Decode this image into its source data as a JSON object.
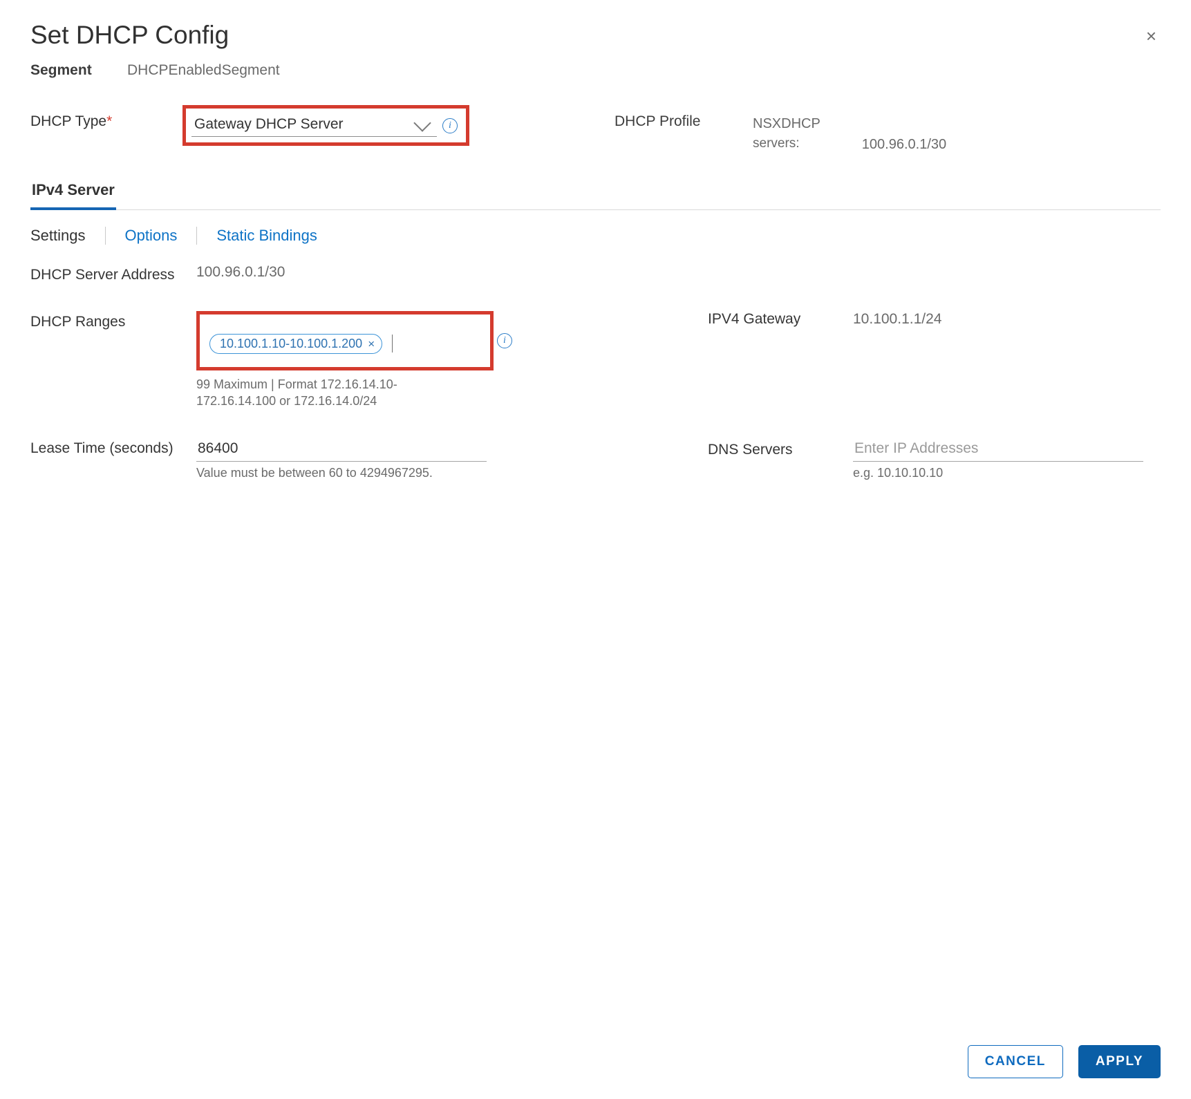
{
  "dialog": {
    "title": "Set DHCP Config",
    "close_glyph": "×"
  },
  "segment": {
    "label": "Segment",
    "value": "DHCPEnabledSegment"
  },
  "dhcp_type": {
    "label": "DHCP Type",
    "required_mark": "*",
    "selected": "Gateway DHCP Server"
  },
  "dhcp_profile": {
    "label": "DHCP Profile",
    "name": "NSXDHCP",
    "servers_label": "servers:",
    "servers_value": "100.96.0.1/30"
  },
  "tab1": {
    "label": "IPv4 Server"
  },
  "subtabs": {
    "settings": "Settings",
    "options": "Options",
    "static_bindings": "Static Bindings"
  },
  "server_address": {
    "label": "DHCP Server Address",
    "value": "100.96.0.1/30"
  },
  "ranges": {
    "label": "DHCP Ranges",
    "chip_value": "10.100.1.10-10.100.1.200",
    "chip_x": "×",
    "help": "99 Maximum | Format 172.16.14.10-172.16.14.100 or 172.16.14.0/24"
  },
  "ipv4_gateway": {
    "label": "IPV4 Gateway",
    "value": "10.100.1.1/24"
  },
  "lease_time": {
    "label": "Lease Time (seconds)",
    "value": "86400",
    "help": "Value must be between 60 to 4294967295."
  },
  "dns_servers": {
    "label": "DNS Servers",
    "placeholder": "Enter IP Addresses",
    "help": "e.g. 10.10.10.10"
  },
  "info_glyph": "i",
  "footer": {
    "cancel": "CANCEL",
    "apply": "APPLY"
  }
}
